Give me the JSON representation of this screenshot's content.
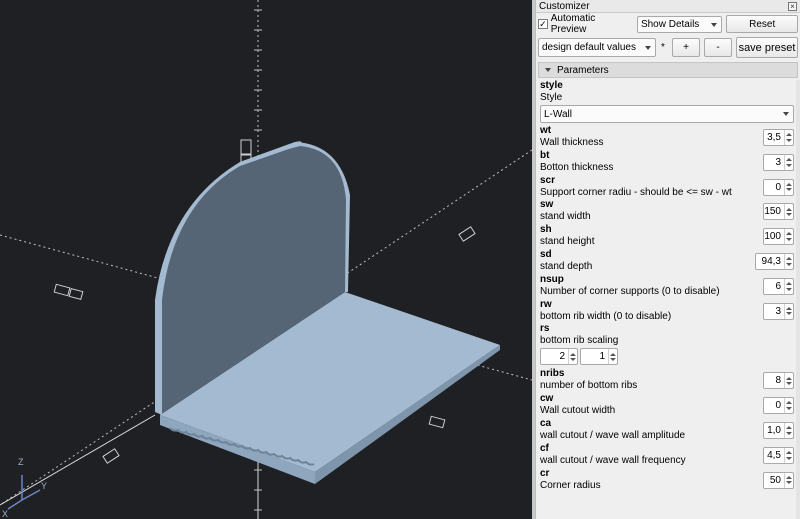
{
  "viewport": {
    "axis_labels": {
      "z": "Z",
      "y": "Y",
      "x": "X"
    },
    "model_color": "#a3bad0",
    "background": "#1f2024"
  },
  "customizer": {
    "title": "Customizer",
    "close_icon": "close-icon",
    "automatic_preview_label": "Automatic Preview",
    "automatic_preview_checked": "✓",
    "details_select": "Show Details",
    "reset_label": "Reset",
    "preset_select": "design default values",
    "modified_marker": "*",
    "add_label": "+",
    "remove_label": "-",
    "save_preset_label": "save preset",
    "parameters_header": "Parameters",
    "style": {
      "name": "style",
      "desc": "Style",
      "value": "L-Wall"
    },
    "params": [
      {
        "name": "wt",
        "desc": "Wall thickness",
        "value": "3,5"
      },
      {
        "name": "bt",
        "desc": "Botton thickness",
        "value": "3"
      },
      {
        "name": "scr",
        "desc": "Support corner radiu - should be <= sw - wt",
        "value": "0"
      },
      {
        "name": "sw",
        "desc": "stand width",
        "value": "150"
      },
      {
        "name": "sh",
        "desc": "stand height",
        "value": "100"
      },
      {
        "name": "sd",
        "desc": "stand depth",
        "value": "94,3"
      },
      {
        "name": "nsup",
        "desc": "Number of corner supports (0 to disable)",
        "value": "6"
      },
      {
        "name": "rw",
        "desc": "bottom rib width (0 to disable)",
        "value": "3"
      }
    ],
    "rs": {
      "name": "rs",
      "desc": "bottom rib scaling",
      "values": [
        "2",
        "1"
      ]
    },
    "params2": [
      {
        "name": "nribs",
        "desc": "number of bottom ribs",
        "value": "8"
      },
      {
        "name": "cw",
        "desc": "Wall cutout width",
        "value": "0"
      },
      {
        "name": "ca",
        "desc": "wall cutout / wave wall amplitude",
        "value": "1,0"
      },
      {
        "name": "cf",
        "desc": "wall cutout / wave wall frequency",
        "value": "4,5"
      },
      {
        "name": "cr",
        "desc": "Corner radius",
        "value": "50"
      }
    ]
  }
}
